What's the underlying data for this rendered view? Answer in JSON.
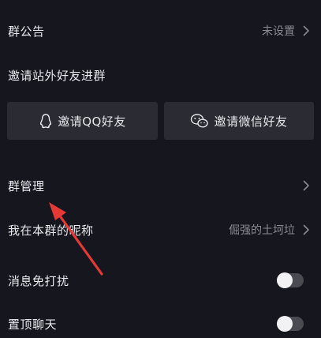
{
  "settings": {
    "announcement": {
      "label": "群公告",
      "value": "未设置"
    },
    "invite_section_label": "邀请站外好友进群",
    "invite_qq_label": "邀请QQ好友",
    "invite_wechat_label": "邀请微信好友",
    "group_manage": {
      "label": "群管理"
    },
    "nickname": {
      "label": "我在本群的昵称",
      "value": "倔强的土坷垃"
    },
    "mute": {
      "label": "消息免打扰",
      "enabled": false
    },
    "pin": {
      "label": "置顶聊天",
      "enabled": false
    }
  },
  "colors": {
    "background": "#16161e",
    "button_bg": "#2b2b33",
    "annotation_arrow": "#e53935"
  },
  "icons": {
    "qq": "qq-penguin-icon",
    "wechat": "wechat-icon",
    "chevron": "chevron-right-icon"
  }
}
